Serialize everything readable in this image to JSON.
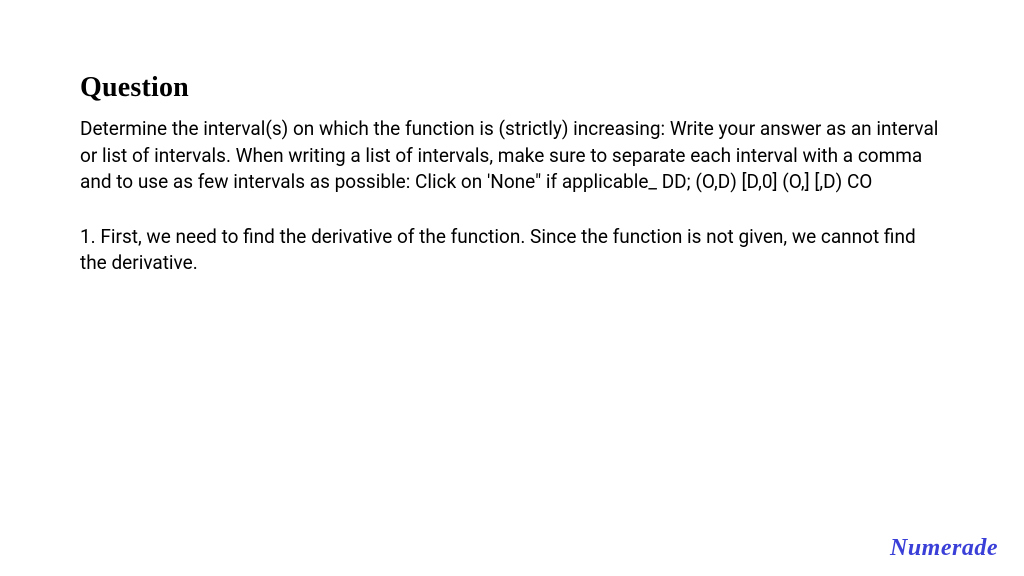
{
  "heading": "Question",
  "paragraph1": "Determine the interval(s) on which the function is (strictly) increasing: Write your answer as an interval or list of intervals. When writing a list of intervals, make sure to separate each interval with a comma and to use as few intervals as possible: Click on 'None\" if applicable_ DD; (O,D) [D,0] (O,] [,D) CO",
  "paragraph2": "1. First, we need to find the derivative of the function. Since the function is not given, we cannot find the derivative.",
  "brand": "Numerade"
}
